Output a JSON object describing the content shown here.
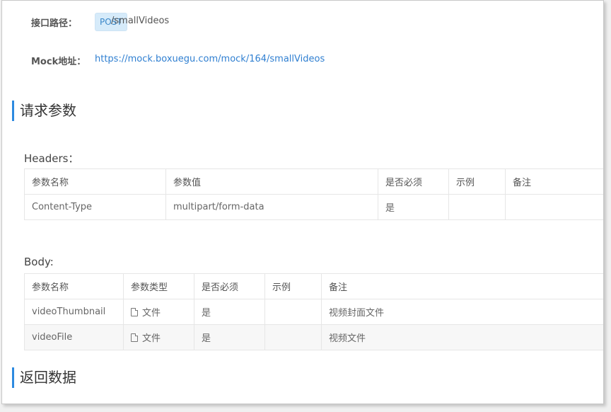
{
  "api": {
    "path_label": "接口路径：",
    "method": "POST",
    "path": "/smallVideos",
    "mock_label": "Mock地址：",
    "mock_url": "https://mock.boxuegu.com/mock/164/smallVideos"
  },
  "sections": {
    "request_title": "请求参数",
    "response_title": "返回数据"
  },
  "headers": {
    "title": "Headers：",
    "columns": [
      "参数名称",
      "参数值",
      "是否必须",
      "示例",
      "备注"
    ],
    "rows": [
      {
        "name": "Content-Type",
        "value": "multipart/form-data",
        "required": "是",
        "example": "",
        "note": ""
      }
    ]
  },
  "body": {
    "title": "Body:",
    "columns": [
      "参数名称",
      "参数类型",
      "是否必须",
      "示例",
      "备注"
    ],
    "rows": [
      {
        "name": "videoThumbnail",
        "type_icon": "file-icon",
        "type": "文件",
        "required": "是",
        "example": "",
        "note": "视频封面文件"
      },
      {
        "name": "videoFile",
        "type_icon": "file-icon",
        "type": "文件",
        "required": "是",
        "example": "",
        "note": "视频文件"
      }
    ]
  },
  "colors": {
    "accent": "#2d8ae0",
    "link": "#2f7fd1",
    "badge_bg": "#d6ebfa"
  }
}
